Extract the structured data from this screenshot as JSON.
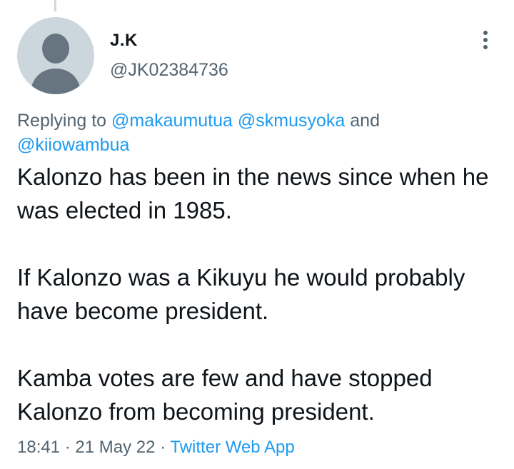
{
  "tweet": {
    "author": {
      "display_name": "J.K",
      "handle": "@JK02384736"
    },
    "reply_context": {
      "prefix": "Replying to",
      "mentions": [
        "@makaumutua",
        "@skmusyoka",
        "@kiiowambua"
      ],
      "conjunction": "and"
    },
    "body": [
      "Kalonzo has been in the news since when he was elected in 1985.",
      "If Kalonzo was a Kikuyu he would probably have become president.",
      "Kamba votes are few and have stopped Kalonzo from becoming president."
    ],
    "time": "18:41",
    "date": "21 May 22",
    "separator": "·",
    "source": "Twitter Web App"
  },
  "icons": {
    "avatar": "default-profile-icon",
    "more": "more-vertical-icon"
  },
  "colors": {
    "primary_text": "#0f1419",
    "secondary_text": "#536471",
    "link": "#1d9bf0",
    "avatar_bg": "#ccd6dd",
    "avatar_figure": "#66757f"
  }
}
